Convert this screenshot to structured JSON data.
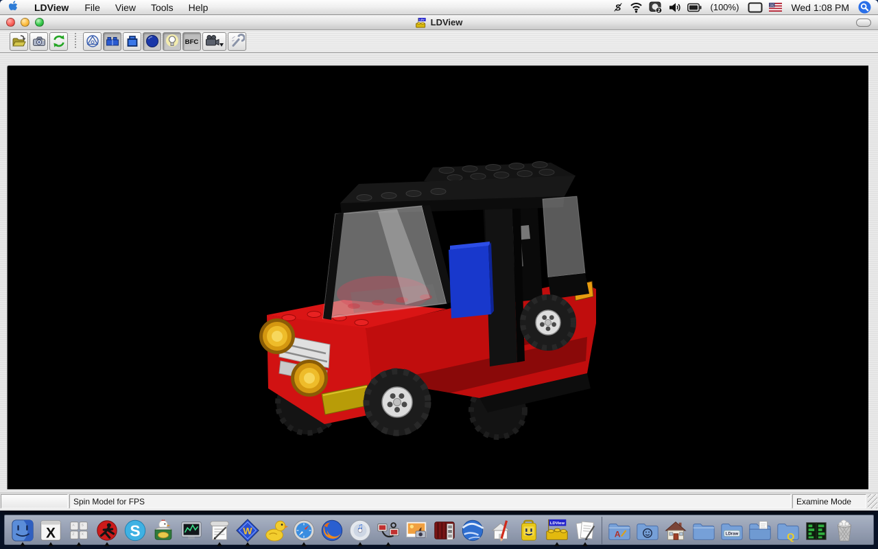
{
  "menu_bar": {
    "app_name": "LDView",
    "menus": [
      "File",
      "View",
      "Tools",
      "Help"
    ],
    "status": {
      "display_badge": "2",
      "battery_percent": "(100%)",
      "clock": "Wed 1:08 PM"
    },
    "icons": [
      "s-script-icon",
      "wifi-icon",
      "display-badge-icon",
      "volume-icon",
      "battery-icon",
      "displays-icon",
      "us-flag-icon",
      "spotlight-icon"
    ]
  },
  "window": {
    "title": "LDView",
    "title_icon_text": "LDV",
    "toolbar": {
      "bfc_label": "BFC",
      "buttons": [
        {
          "name": "open-file",
          "pressed": false
        },
        {
          "name": "save-snapshot",
          "pressed": false
        },
        {
          "name": "reload",
          "pressed": false
        },
        {
          "name": "wireframe",
          "pressed": false
        },
        {
          "name": "seams",
          "pressed": true
        },
        {
          "name": "edge-lines",
          "pressed": false
        },
        {
          "name": "primitive-substitution",
          "pressed": true
        },
        {
          "name": "lighting",
          "pressed": true
        },
        {
          "name": "bfc",
          "pressed": true
        },
        {
          "name": "select-view",
          "pressed": false
        },
        {
          "name": "preferences",
          "pressed": false
        }
      ]
    },
    "viewport": {
      "background": "#000000",
      "model": {
        "subject": "Red LEGO off-road car with black roof rack, transparent windows, blue door and amber headlights",
        "colors": {
          "body": "#c8100f",
          "roof": "#141414",
          "door": "#1838cc",
          "headlights": "#eebc2a",
          "windows": "rgba(210,210,210,0.5)",
          "wheel_hub": "#dcdcdc",
          "tire": "#1c1c1c"
        }
      }
    },
    "status_bar": {
      "status_text": "Spin Model for FPS",
      "mode_text": "Examine Mode"
    }
  },
  "dock": {
    "items": [
      {
        "name": "finder",
        "running": true
      },
      {
        "name": "x11",
        "running": true
      },
      {
        "name": "keyboard-viewer",
        "running": true
      },
      {
        "name": "red-silhouette-app",
        "running": true
      },
      {
        "name": "skype",
        "running": false
      },
      {
        "name": "chicken-of-the-vnc",
        "running": false
      },
      {
        "name": "activity-monitor",
        "running": false
      },
      {
        "name": "script-editor",
        "running": true
      },
      {
        "name": "wing-ide",
        "running": true
      },
      {
        "name": "cyberduck",
        "running": false
      },
      {
        "name": "safari",
        "running": true
      },
      {
        "name": "firefox",
        "running": false
      },
      {
        "name": "itunes",
        "running": true
      },
      {
        "name": "teleport",
        "running": true
      },
      {
        "name": "iphoto",
        "running": false
      },
      {
        "name": "photo-booth",
        "running": false
      },
      {
        "name": "google-earth",
        "running": false
      },
      {
        "name": "sketchup",
        "running": false
      },
      {
        "name": "yellow-canister-app",
        "running": false
      },
      {
        "name": "ldview",
        "running": true,
        "badge": "LDView"
      },
      {
        "name": "text-editor",
        "running": true
      },
      {
        "name": "dock-separator",
        "type": "separator"
      },
      {
        "name": "folder-applications",
        "running": false
      },
      {
        "name": "folder-smiley",
        "running": false
      },
      {
        "name": "folder-home",
        "running": false
      },
      {
        "name": "folder-plain",
        "running": false
      },
      {
        "name": "folder-ldraw",
        "running": false,
        "label": "LDraw"
      },
      {
        "name": "folder-documents",
        "running": false
      },
      {
        "name": "folder-q",
        "running": false,
        "label": "Q"
      },
      {
        "name": "green-screen-app",
        "running": false
      },
      {
        "name": "trash",
        "running": false
      }
    ]
  }
}
